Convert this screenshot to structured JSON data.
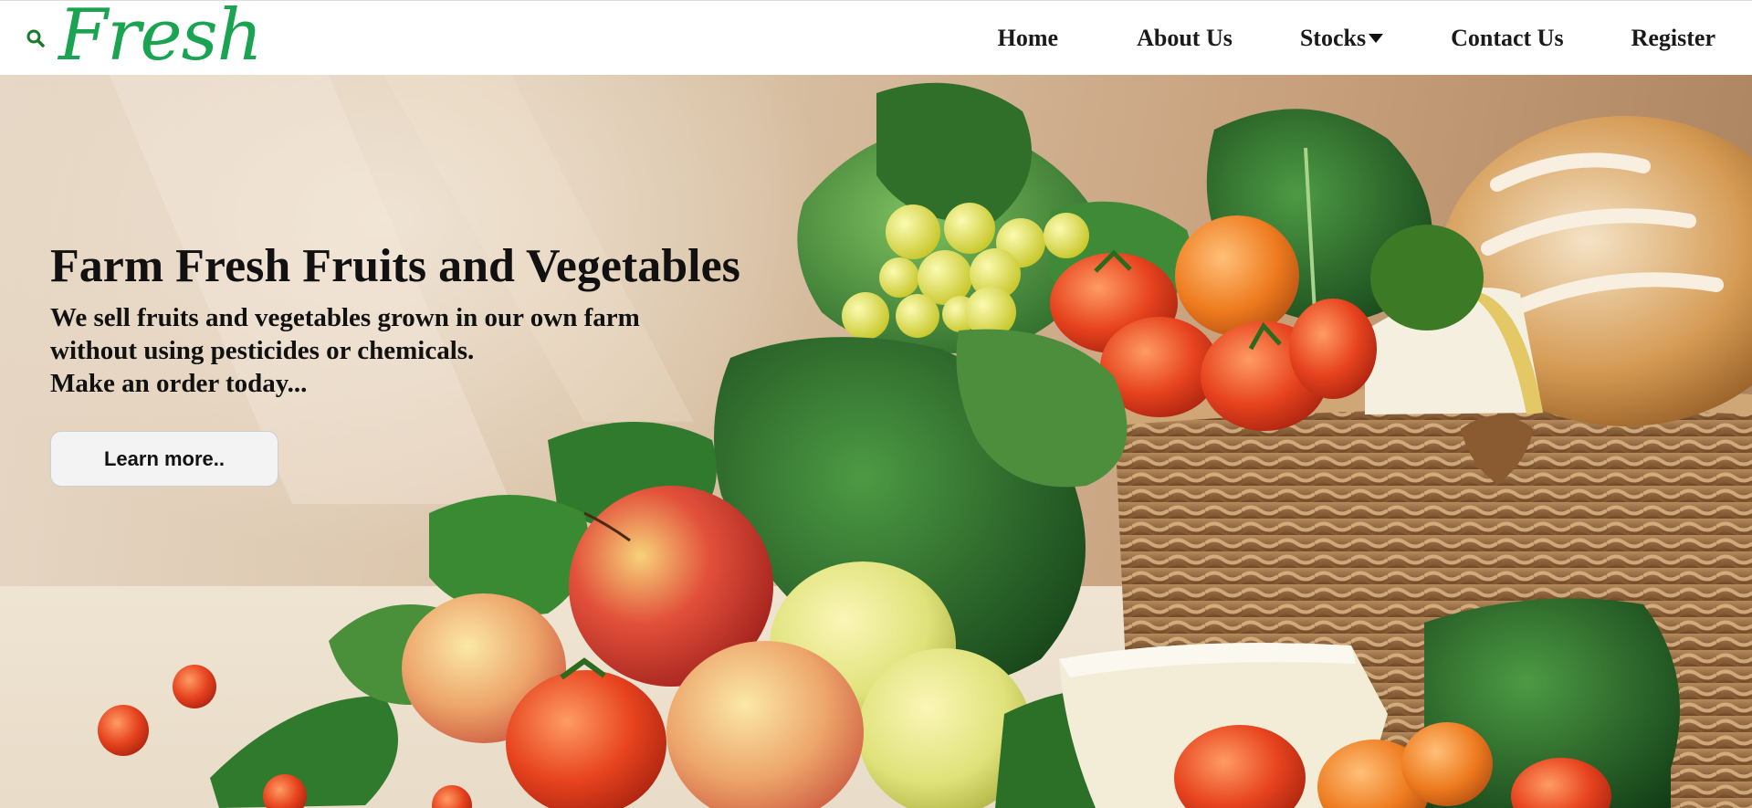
{
  "header": {
    "logo_text": "Fresh",
    "search_icon": "search-icon",
    "nav": {
      "home": "Home",
      "about": "About Us",
      "stocks": "Stocks",
      "contact": "Contact Us",
      "register": "Register"
    },
    "stocks_icon": "caret-down-icon"
  },
  "hero": {
    "title": "Farm Fresh Fruits and Vegetables",
    "line1": "We sell fruits and vegetables grown in our own farm",
    "line2": "without using pesticides or chemicals.",
    "line3": "Make an order today...",
    "button_label": "Learn more.."
  },
  "colors": {
    "brand_green": "#1aa451",
    "nav_text": "#1a1a1a",
    "hero_text": "#111111",
    "button_bg": "#f3f3f3"
  }
}
